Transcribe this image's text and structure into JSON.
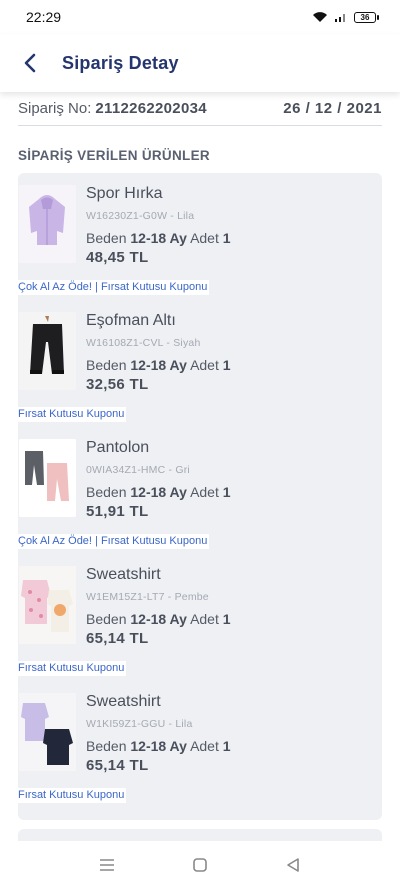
{
  "status_bar": {
    "time": "22:29",
    "battery": "36"
  },
  "header": {
    "title": "Sipariş Detay"
  },
  "order": {
    "number_label": "Sipariş No:",
    "number": "2112262202034",
    "date": "26 / 12 / 2021"
  },
  "section": {
    "title": "SİPARİŞ VERİLEN ÜRÜNLER"
  },
  "labels": {
    "size": "Beden",
    "qty": "Adet"
  },
  "products": [
    {
      "name": "Spor Hırka",
      "sku": "W16230Z1-G0W - Lila",
      "size": "12-18 Ay",
      "qty": "1",
      "price": "48,45 TL",
      "coupon": "Çok Al Az Öde! | Fırsat Kutusu Kuponu"
    },
    {
      "name": "Eşofman Altı",
      "sku": "W16108Z1-CVL - Siyah",
      "size": "12-18 Ay",
      "qty": "1",
      "price": "32,56 TL",
      "coupon": "Fırsat Kutusu Kuponu"
    },
    {
      "name": "Pantolon",
      "sku": "0WIA34Z1-HMC - Gri",
      "size": "12-18 Ay",
      "qty": "1",
      "price": "51,91 TL",
      "coupon": "Çok Al Az Öde! | Fırsat Kutusu Kuponu"
    },
    {
      "name": "Sweatshirt",
      "sku": "W1EM15Z1-LT7 - Pembe",
      "size": "12-18 Ay",
      "qty": "1",
      "price": "65,14 TL",
      "coupon": "Fırsat Kutusu Kuponu"
    },
    {
      "name": "Sweatshirt",
      "sku": "W1KI59Z1-GGU - Lila",
      "size": "12-18 Ay",
      "qty": "1",
      "price": "65,14 TL",
      "coupon": "Fırsat Kutusu Kuponu"
    }
  ],
  "colors": {
    "title": "#25356e",
    "link": "#3b66c9",
    "card_bg": "#eef0f3"
  }
}
